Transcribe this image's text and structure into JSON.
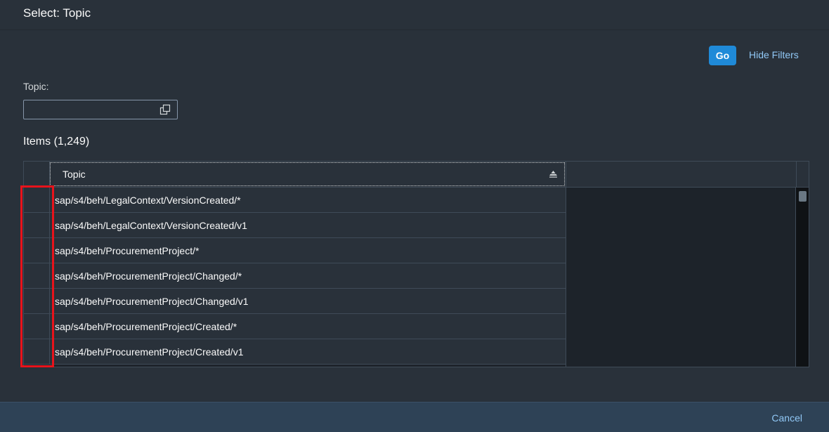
{
  "dialog": {
    "title": "Select: Topic"
  },
  "filterbar": {
    "go_label": "Go",
    "hide_filters_label": "Hide Filters",
    "topic_label": "Topic:",
    "topic_value": ""
  },
  "table": {
    "title": "Items (1,249)",
    "column_header": "Topic",
    "rows": [
      "sap/s4/beh/LegalContext/VersionCreated/*",
      "sap/s4/beh/LegalContext/VersionCreated/v1",
      "sap/s4/beh/ProcurementProject/*",
      "sap/s4/beh/ProcurementProject/Changed/*",
      "sap/s4/beh/ProcurementProject/Changed/v1",
      "sap/s4/beh/ProcurementProject/Created/*",
      "sap/s4/beh/ProcurementProject/Created/v1"
    ]
  },
  "footer": {
    "cancel_label": "Cancel"
  },
  "colors": {
    "accent": "#1f8ad8",
    "link": "#91c8f6",
    "highlight": "#e8131b"
  },
  "icons": {
    "value_help": "value-help-icon",
    "sort": "sort-ascending-icon"
  }
}
